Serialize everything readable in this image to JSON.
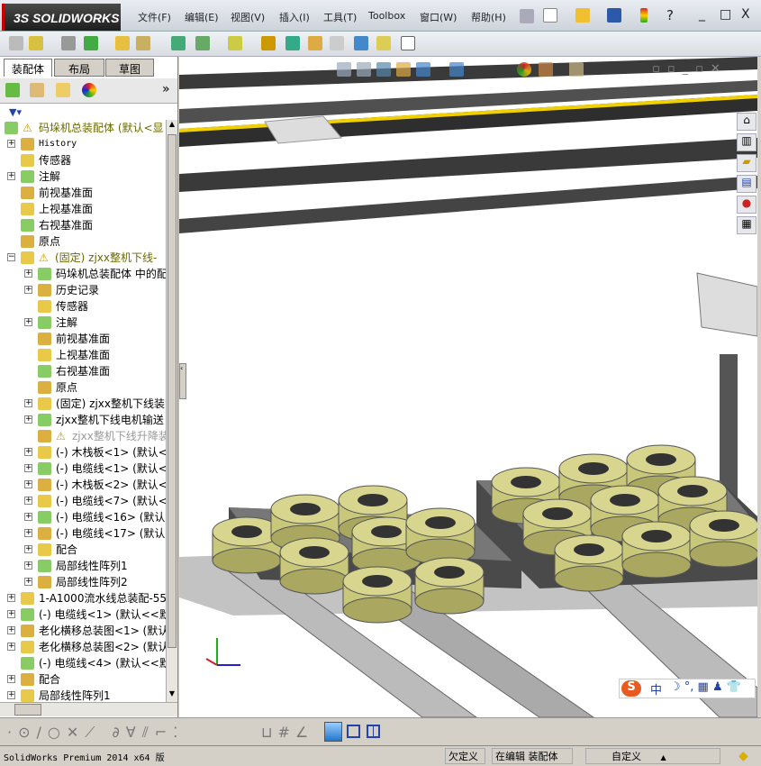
{
  "app": {
    "logo": "SOLIDWORKS",
    "logo_prefix": "3S"
  },
  "menu": [
    {
      "label": "文件(F)"
    },
    {
      "label": "编辑(E)"
    },
    {
      "label": "视图(V)"
    },
    {
      "label": "插入(I)"
    },
    {
      "label": "工具(T)"
    },
    {
      "label": "Toolbox"
    },
    {
      "label": "窗口(W)"
    },
    {
      "label": "帮助(H)"
    }
  ],
  "window_controls": {
    "minimize": "_",
    "maximize": "□",
    "close": "X"
  },
  "panel": {
    "tabs": [
      {
        "label": "装配体",
        "active": true
      },
      {
        "label": "布局"
      },
      {
        "label": "草图"
      }
    ],
    "more": "»"
  },
  "tree": [
    {
      "label": "码垛机总装配体  (默认<显",
      "level": 0,
      "warn": true,
      "color": "#6b6b00"
    },
    {
      "label": "History",
      "level": 1,
      "exp": "+",
      "mono": true
    },
    {
      "label": "传感器",
      "level": 1
    },
    {
      "label": "注解",
      "level": 1,
      "exp": "+"
    },
    {
      "label": "前视基准面",
      "level": 1
    },
    {
      "label": "上视基准面",
      "level": 1
    },
    {
      "label": "右视基准面",
      "level": 1
    },
    {
      "label": "原点",
      "level": 1
    },
    {
      "label": "(固定) zjxx整机下线-",
      "level": 1,
      "exp": "-",
      "warn": true,
      "color": "#6b6b00"
    },
    {
      "label": "码垛机总装配体 中的配",
      "level": 2,
      "exp": "+"
    },
    {
      "label": "历史记录",
      "level": 2,
      "exp": "+"
    },
    {
      "label": "传感器",
      "level": 2
    },
    {
      "label": "注解",
      "level": 2,
      "exp": "+"
    },
    {
      "label": "前视基准面",
      "level": 2
    },
    {
      "label": "上视基准面",
      "level": 2
    },
    {
      "label": "右视基准面",
      "level": 2
    },
    {
      "label": "原点",
      "level": 2
    },
    {
      "label": "(固定) zjxx整机下线装",
      "level": 2,
      "exp": "+"
    },
    {
      "label": "zjxx整机下线电机输送",
      "level": 2,
      "exp": "+"
    },
    {
      "label": "zjxx整机下线升降装",
      "level": 2,
      "warn": true,
      "color": "#999"
    },
    {
      "label": "(-) 木栈板<1> (默认<",
      "level": 2,
      "exp": "+"
    },
    {
      "label": "(-) 电缆线<1> (默认<",
      "level": 2,
      "exp": "+"
    },
    {
      "label": "(-) 木栈板<2> (默认<",
      "level": 2,
      "exp": "+"
    },
    {
      "label": "(-) 电缆线<7> (默认<",
      "level": 2,
      "exp": "+"
    },
    {
      "label": "(-) 电缆线<16> (默认",
      "level": 2,
      "exp": "+"
    },
    {
      "label": "(-) 电缆线<17> (默认",
      "level": 2,
      "exp": "+"
    },
    {
      "label": "配合",
      "level": 2,
      "exp": "+"
    },
    {
      "label": "局部线性阵列1",
      "level": 2,
      "exp": "+"
    },
    {
      "label": "局部线性阵列2",
      "level": 2,
      "exp": "+"
    },
    {
      "label": "1-A1000流水线总装配-55-",
      "level": 1,
      "exp": "+"
    },
    {
      "label": "(-) 电缆线<1> (默认<<默",
      "level": 1,
      "exp": "+"
    },
    {
      "label": "老化横移总装图<1> (默认",
      "level": 1,
      "exp": "+"
    },
    {
      "label": "老化横移总装图<2> (默认",
      "level": 1,
      "exp": "+"
    },
    {
      "label": "(-) 电缆线<4> (默认<<默",
      "level": 1
    },
    {
      "label": "配合",
      "level": 1,
      "exp": "+"
    },
    {
      "label": "局部线性阵列1",
      "level": 1,
      "exp": "+"
    }
  ],
  "ime": {
    "label": "中"
  },
  "status": {
    "product": "SolidWorks Premium 2014 x64 版",
    "state": "欠定义",
    "mode": "在编辑 装配体",
    "units": "自定义",
    "units_arrow": "▲"
  },
  "colors": {
    "ring": "#c9c77a",
    "rail": "#3a3a3a",
    "accent": "#f0d000"
  }
}
